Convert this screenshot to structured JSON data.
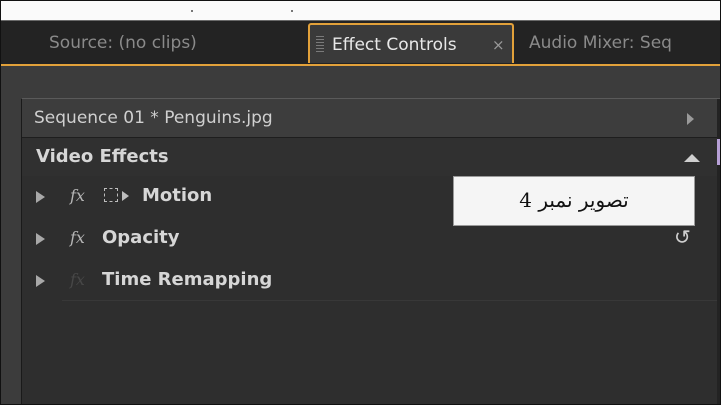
{
  "tabs": {
    "source": "Source: (no clips)",
    "effect_controls": "Effect Controls",
    "effect_controls_close": "×",
    "audio_mixer": "Audio Mixer: Seq"
  },
  "sequence": {
    "label": "Sequence 01 * Penguins.jpg"
  },
  "video_effects": {
    "header": "Video Effects",
    "items": [
      {
        "fx": "fx",
        "label": "Motion"
      },
      {
        "fx": "fx",
        "label": "Opacity"
      },
      {
        "fx": "fx",
        "label": "Time Remapping"
      }
    ]
  },
  "overlay": {
    "caption": "تصویر نمبر 4"
  },
  "colors": {
    "accent_border": "#e2a13a",
    "panel_bg": "#2e2e2e",
    "selection_mark": "#b7a0d6"
  }
}
